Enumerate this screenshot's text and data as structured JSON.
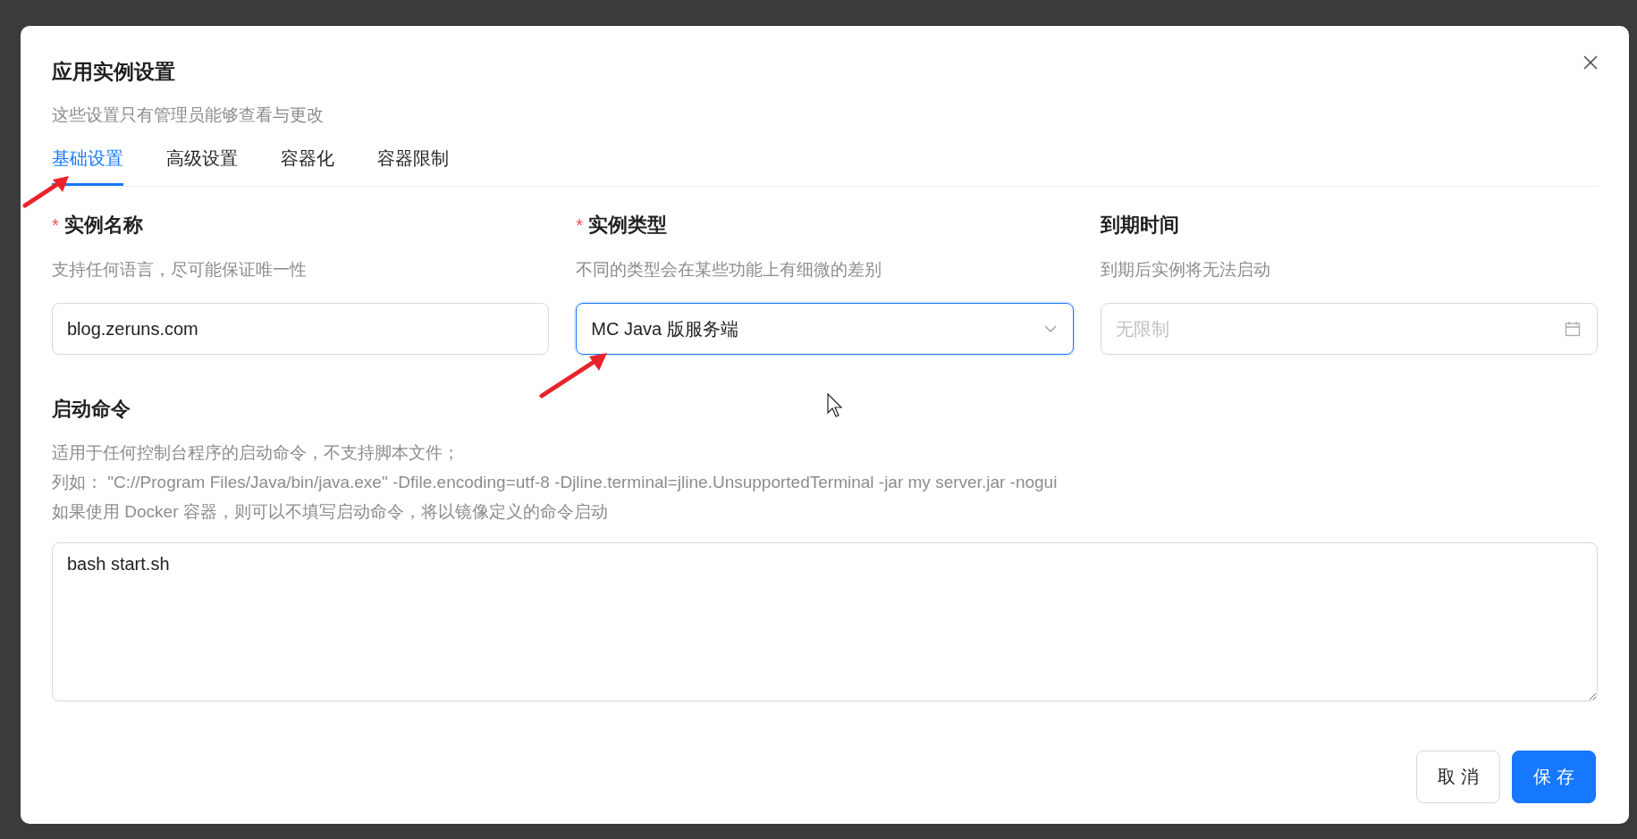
{
  "dialog": {
    "title": "应用实例设置",
    "subtitle": "这些设置只有管理员能够查看与更改"
  },
  "tabs": [
    {
      "label": "基础设置",
      "selected": true
    },
    {
      "label": "高级设置",
      "selected": false
    },
    {
      "label": "容器化",
      "selected": false
    },
    {
      "label": "容器限制",
      "selected": false
    }
  ],
  "fields": [
    {
      "label": "实例名称",
      "required_mark": "*",
      "hint": "支持任何语言，尽可能保证唯一性",
      "kind": "text",
      "value": "blog.zeruns.com",
      "focused": false
    },
    {
      "label": "实例类型",
      "required_mark": "*",
      "hint": "不同的类型会在某些功能上有细微的差别",
      "kind": "select",
      "value": "MC Java 版服务端",
      "focused": true
    },
    {
      "label": "到期时间",
      "hint": "到期后实例将无法启动",
      "kind": "date",
      "placeholder": "无限制",
      "focused": false
    }
  ],
  "command": {
    "label": "启动命令",
    "hints": [
      "适用于任何控制台程序的启动命令，不支持脚本文件；",
      "列如： \"C://Program Files/Java/bin/java.exe\" -Dfile.encoding=utf-8 -Djline.terminal=jline.UnsupportedTerminal -jar my server.jar -nogui",
      "如果使用 Docker 容器，则可以不填写启动命令，将以镜像定义的命令启动"
    ],
    "value": "bash start.sh"
  },
  "buttons": [
    {
      "label": "取 消",
      "kind": "default"
    },
    {
      "label": "保 存",
      "kind": "primary"
    }
  ]
}
